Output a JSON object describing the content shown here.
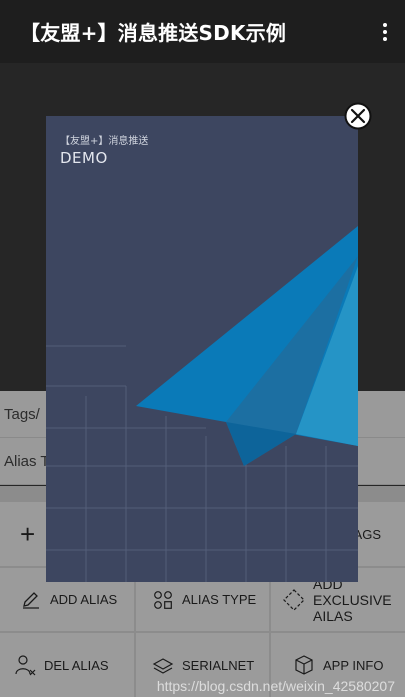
{
  "appbar": {
    "title": "【友盟+】消息推送SDK示例",
    "menu_icon": "overflow-menu-icon"
  },
  "fields": {
    "tags_label": "Tags/",
    "alias_label": "Alias T"
  },
  "buttons": {
    "add": "+",
    "tags": "AGS",
    "add_alias": "ADD ALIAS",
    "alias_type": "ALIAS TYPE",
    "add_exclusive": "ADD\nEXCLUSIVE\nAILAS",
    "del_alias": "DEL  ALIAS",
    "serialnet": "SERIALNET",
    "app_info": "APP INFO"
  },
  "popup": {
    "subtitle": "【友盟+】消息推送",
    "title": "DEMO",
    "close_icon": "close-circle-icon"
  },
  "watermark": "https://blog.csdn.net/weixin_42580207",
  "colors": {
    "card_bg": "#3d4660",
    "plane": "#0077b3",
    "appbar": "#1e1e1e"
  }
}
